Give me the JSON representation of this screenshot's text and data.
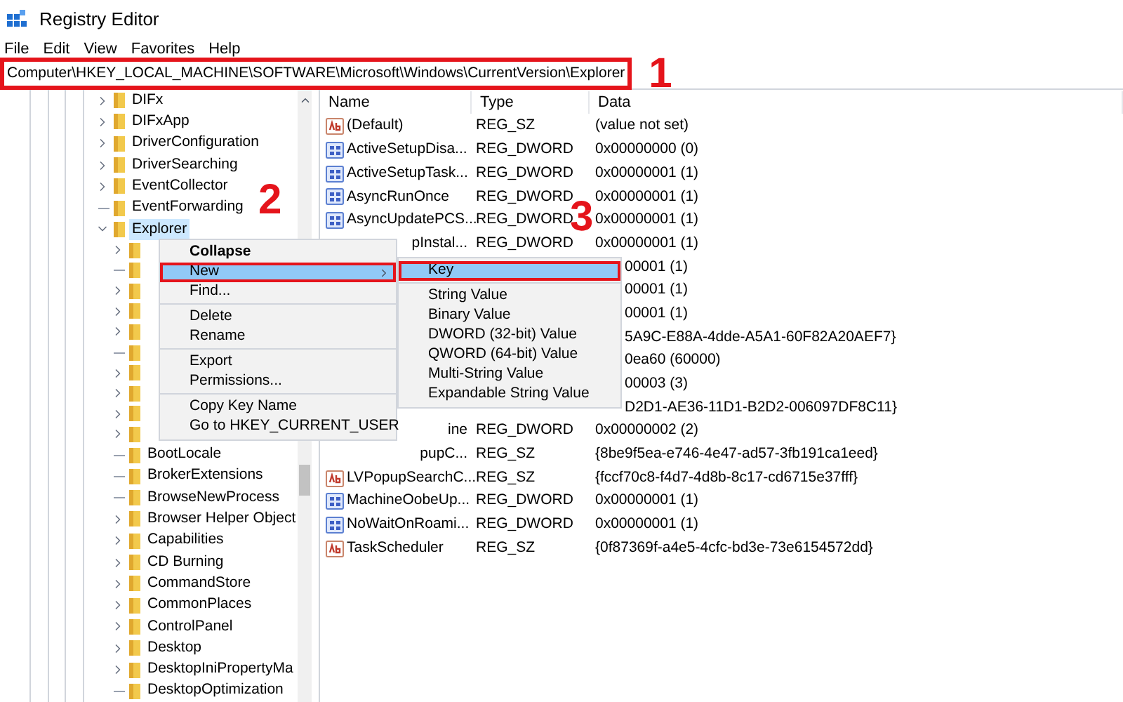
{
  "window": {
    "title": "Registry Editor"
  },
  "menu_bar": [
    "File",
    "Edit",
    "View",
    "Favorites",
    "Help"
  ],
  "address_bar": {
    "value": "Computer\\HKEY_LOCAL_MACHINE\\SOFTWARE\\Microsoft\\Windows\\CurrentVersion\\Explorer",
    "annotated": true
  },
  "tree": [
    {
      "label": "DIFx",
      "expandable": true,
      "selected": false
    },
    {
      "label": "DIFxApp",
      "expandable": true,
      "selected": false
    },
    {
      "label": "DriverConfiguration",
      "expandable": true,
      "selected": false
    },
    {
      "label": "DriverSearching",
      "expandable": true,
      "selected": false
    },
    {
      "label": "EventCollector",
      "expandable": true,
      "selected": false
    },
    {
      "label": "EventForwarding",
      "expandable": false,
      "selected": false
    },
    {
      "label": "Explorer",
      "expandable": true,
      "expanded": true,
      "selected": true,
      "children": [
        {
          "expandable": true
        },
        {
          "expandable": false
        },
        {
          "expandable": true
        },
        {
          "expandable": true
        },
        {
          "expandable": true
        },
        {
          "expandable": false
        },
        {
          "expandable": true
        },
        {
          "expandable": true
        },
        {
          "expandable": true
        },
        {
          "expandable": true
        },
        {
          "label": "BootLocale",
          "expandable": false,
          "selected": false
        },
        {
          "label": "BrokerExtensions",
          "expandable": false,
          "selected": false
        },
        {
          "label": "BrowseNewProcess",
          "expandable": false,
          "selected": false
        },
        {
          "label": "Browser Helper Object",
          "expandable": true,
          "selected": false
        },
        {
          "label": "Capabilities",
          "expandable": true,
          "selected": false
        },
        {
          "label": "CD Burning",
          "expandable": true,
          "selected": false
        },
        {
          "label": "CommandStore",
          "expandable": true,
          "selected": false
        },
        {
          "label": "CommonPlaces",
          "expandable": true,
          "selected": false
        },
        {
          "label": "ControlPanel",
          "expandable": true,
          "selected": false
        },
        {
          "label": "Desktop",
          "expandable": true,
          "selected": false
        },
        {
          "label": "DesktopIniPropertyMa",
          "expandable": true,
          "selected": false
        },
        {
          "label": "DesktopOptimization",
          "expandable": false,
          "selected": false
        }
      ]
    }
  ],
  "table": {
    "columns": [
      "Name",
      "Type",
      "Data"
    ],
    "rows": [
      {
        "kind": "string",
        "name": "(Default)",
        "type": "REG_SZ",
        "data": "(value not set)"
      },
      {
        "kind": "dword",
        "name": "ActiveSetupDisa...",
        "type": "REG_DWORD",
        "data": "0x00000000 (0)"
      },
      {
        "kind": "dword",
        "name": "ActiveSetupTask...",
        "type": "REG_DWORD",
        "data": "0x00000001 (1)"
      },
      {
        "kind": "dword",
        "name": "AsyncRunOnce",
        "type": "REG_DWORD",
        "data": "0x00000001 (1)"
      },
      {
        "kind": "dword",
        "name": "AsyncUpdatePCS...",
        "type": "REG_DWORD",
        "data": "0x00000001 (1)"
      },
      {
        "kind": "under_menu",
        "name": "pInstal...",
        "type": "REG_DWORD",
        "data": "0x00000001 (1)"
      },
      {
        "kind": "under_submenu",
        "data": "00001 (1)"
      },
      {
        "kind": "under_submenu",
        "data": "00001 (1)"
      },
      {
        "kind": "under_submenu",
        "data": "00001 (1)"
      },
      {
        "kind": "under_submenu",
        "data": "5A9C-E88A-4dde-A5A1-60F82A20AEF7}"
      },
      {
        "kind": "under_submenu",
        "data": "0ea60 (60000)"
      },
      {
        "kind": "under_submenu",
        "data": "00003 (3)"
      },
      {
        "kind": "under_submenu",
        "data": "D2D1-AE36-11D1-B2D2-006097DF8C11}"
      },
      {
        "kind": "under_menu",
        "name": "ine",
        "type": "REG_DWORD",
        "data": "0x00000002 (2)"
      },
      {
        "kind": "under_menu",
        "name": "pupC...",
        "type": "REG_SZ",
        "data": "{8be9f5ea-e746-4e47-ad57-3fb191ca1eed}"
      },
      {
        "kind": "string",
        "name": "LVPopupSearchC...",
        "type": "REG_SZ",
        "data": "{fccf70c8-f4d7-4d8b-8c17-cd6715e37fff}"
      },
      {
        "kind": "dword",
        "name": "MachineOobeUp...",
        "type": "REG_DWORD",
        "data": "0x00000001 (1)"
      },
      {
        "kind": "dword",
        "name": "NoWaitOnRoami...",
        "type": "REG_DWORD",
        "data": "0x00000001 (1)"
      },
      {
        "kind": "string",
        "name": "TaskScheduler",
        "type": "REG_SZ",
        "data": "{0f87369f-a4e5-4cfc-bd3e-73e6154572dd}"
      }
    ]
  },
  "context_menu": {
    "groups": [
      [
        {
          "label": "Collapse",
          "bold": true,
          "selected": false
        },
        {
          "label": "New",
          "submenu": true,
          "selected": true,
          "annotated": true
        },
        {
          "label": "Find...",
          "selected": false
        }
      ],
      [
        {
          "label": "Delete",
          "selected": false
        },
        {
          "label": "Rename",
          "selected": false
        }
      ],
      [
        {
          "label": "Export",
          "selected": false
        },
        {
          "label": "Permissions...",
          "selected": false
        }
      ],
      [
        {
          "label": "Copy Key Name",
          "selected": false
        },
        {
          "label": "Go to HKEY_CURRENT_USER",
          "selected": false
        }
      ]
    ]
  },
  "submenu": {
    "groups": [
      [
        {
          "label": "Key",
          "selected": true,
          "annotated": true
        }
      ],
      [
        {
          "label": "String Value",
          "selected": false
        },
        {
          "label": "Binary Value",
          "selected": false
        },
        {
          "label": "DWORD (32-bit) Value",
          "selected": false
        },
        {
          "label": "QWORD (64-bit) Value",
          "selected": false
        },
        {
          "label": "Multi-String Value",
          "selected": false
        },
        {
          "label": "Expandable String Value",
          "selected": false
        }
      ]
    ]
  },
  "annotations": [
    {
      "label": "1"
    },
    {
      "label": "2"
    },
    {
      "label": "3"
    }
  ]
}
